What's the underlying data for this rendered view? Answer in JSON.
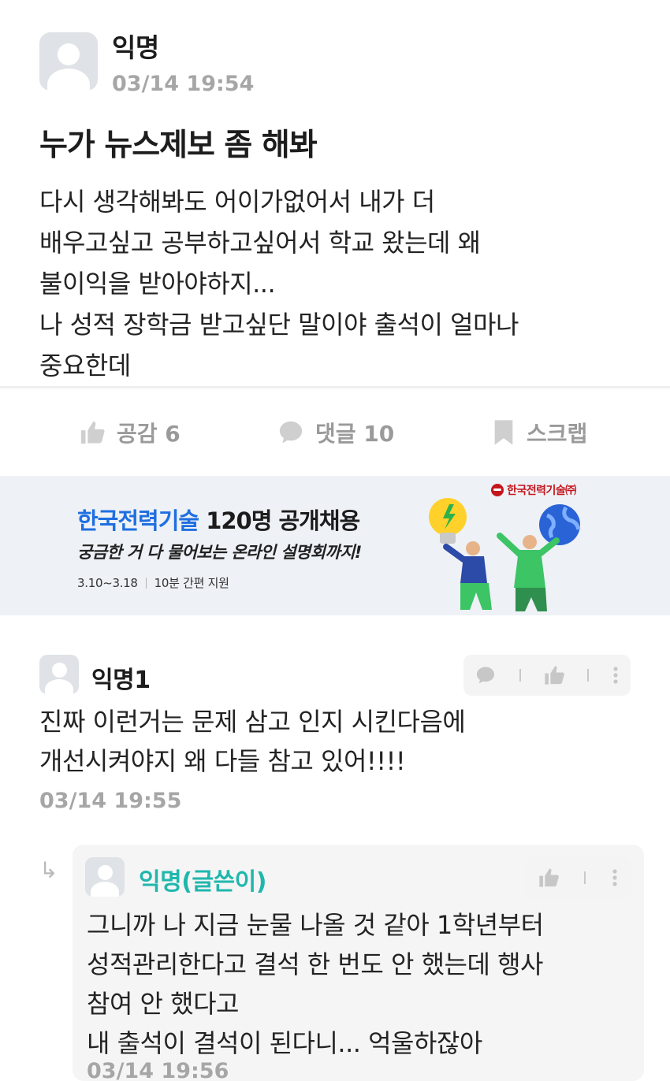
{
  "post": {
    "author": "익명",
    "time": "03/14 19:54",
    "title": "누가 뉴스제보 좀 해봐",
    "body_lines": [
      "다시 생각해봐도 어이가없어서 내가 더",
      "배우고싶고 공부하고싶어서 학교 왔는데 왜",
      "불이익을 받아야하지...",
      "나 성적 장학금 받고싶단 말이야 출석이 얼마나",
      "중요한데"
    ]
  },
  "actions": {
    "like_label": "공감 6",
    "comment_label": "댓글 10",
    "scrap_label": "스크랩"
  },
  "banner": {
    "company": "한국전력기술",
    "title_rest": " 120명 공개채용",
    "subtitle": "궁금한 거 다 물어보는 온라인 설명회까지!",
    "date": "3.10~3.18",
    "note": "10분 간편 지원",
    "logo_text": "한국전력기술㈜"
  },
  "comments": [
    {
      "author": "익명1",
      "body_lines": [
        "진짜 이런거는 문제 삼고 인지 시킨다음에",
        "개선시켜야지 왜 다들 참고 있어!!!!"
      ],
      "time": "03/14 19:55"
    }
  ],
  "reply": {
    "arrow": "↳",
    "author": "익명(글쓴이)",
    "author_color": "#1fb7ad",
    "body_lines": [
      "그니까 나 지금 눈물 나올 것 같아 1학년부터",
      "성적관리한다고 결석 한 번도 안 했는데 행사",
      "참여 안 했다고",
      "내 출석이 결석이 된다니... 억울하잖아"
    ],
    "time": "03/14 19:56"
  },
  "colors": {
    "accent_blue": "#1f6fe0",
    "muted_gray": "#a6a6a6",
    "banner_bg": "#eef1f6"
  },
  "icons": [
    "thumbs-up-icon",
    "speech-bubble-icon",
    "bookmark-icon",
    "more-dots-icon",
    "reply-arrow-icon"
  ]
}
